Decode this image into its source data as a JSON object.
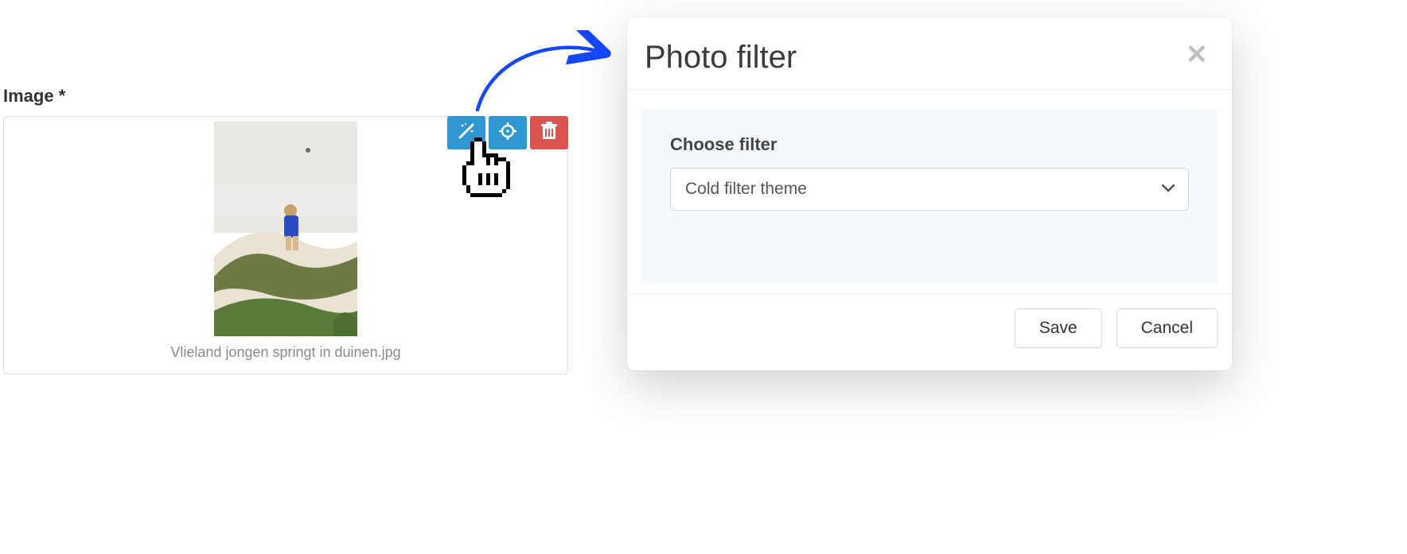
{
  "field": {
    "label": "Image *",
    "caption": "Vlieland jongen springt in duinen.jpg"
  },
  "toolbar": {
    "filter_icon": "magic-wand-icon",
    "focus_icon": "crosshair-icon",
    "delete_icon": "trash-icon"
  },
  "modal": {
    "title": "Photo filter",
    "body_label": "Choose filter",
    "selected": "Cold filter theme",
    "save_label": "Save",
    "cancel_label": "Cancel"
  }
}
